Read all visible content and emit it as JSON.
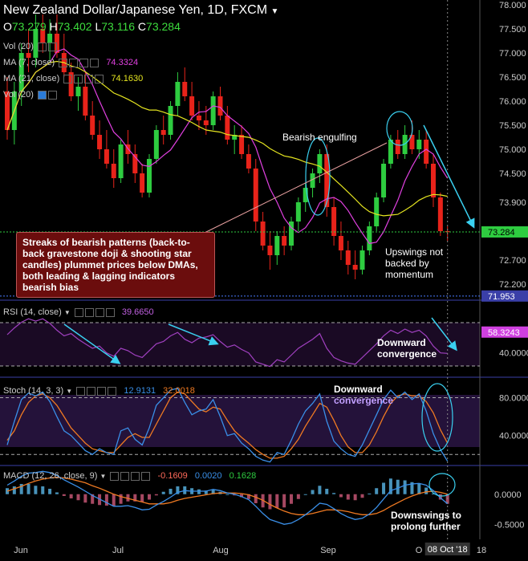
{
  "header": {
    "symbol": "New Zealand Dollar/Japanese Yen, 1D, FXCM",
    "open_label": "O",
    "open": "73.279",
    "high_label": "H",
    "high": "73.402",
    "low_label": "L",
    "low": "73.116",
    "close_label": "C",
    "close": "73.284"
  },
  "indicators": {
    "vol": "Vol (20)",
    "ma7": "MA (7, close)",
    "ma7_value": "74.3324",
    "ma21": "MA (21, close)",
    "ma21_value": "74.1630",
    "vol2": "Vol (20)",
    "rsi": "RSI (14, close)",
    "rsi_value": "39.6650",
    "stoch": "Stoch (14, 3, 3)",
    "stoch_k": "12.9131",
    "stoch_d": "32.0018",
    "macd": "MACD (12, 26, close, 9)",
    "macd_value": "-0.1609",
    "macd_signal": "0.0020",
    "macd_hist": "0.1628"
  },
  "annotations": {
    "callout": "Streaks of bearish patterns (back-to-back gravestone doji & shooting star candles) plummet prices below DMAs, both leading & lagging indicators bearish bias",
    "engulfing": "Bearish engulfing",
    "upswings": "Upswings not backed by momentum",
    "rsi_div_1": "Downward",
    "rsi_div_2": "convergence",
    "stoch_div_1": "Downward",
    "stoch_div_2": "convergence",
    "macd_note_1": "Downswings to",
    "macd_note_2": "prolong further"
  },
  "colors": {
    "up": "#2ecc40",
    "down": "#e8231a",
    "ma7": "#e040e0",
    "ma21": "#e5e520",
    "rsi": "#a040c0",
    "stoch_k": "#3a8fe8",
    "stoch_d": "#f07a22",
    "macd": "#3a8fe8",
    "signal": "#f07a22",
    "cyan": "#3ad0f0"
  },
  "chart_data": {
    "type": "candlestick",
    "price_axis": {
      "ticks": [
        "78.000",
        "77.500",
        "77.000",
        "76.500",
        "76.000",
        "75.500",
        "75.000",
        "74.500",
        "73.900",
        "73.300",
        "72.700",
        "72.200"
      ],
      "current": "73.284",
      "low_marker": "71.953",
      "ylim": [
        71.9,
        78.1
      ]
    },
    "x_axis": {
      "labels": [
        "Jun",
        "Jul",
        "Aug",
        "Sep",
        "O",
        "18"
      ],
      "current_date": "08 Oct '18"
    },
    "candles": [
      [
        76.2,
        76.5,
        75.2,
        75.4
      ],
      [
        75.4,
        76.4,
        75.1,
        76.2
      ],
      [
        76.2,
        77.2,
        75.9,
        77.0
      ],
      [
        77.0,
        77.5,
        76.6,
        76.9
      ],
      [
        76.9,
        77.8,
        76.7,
        77.5
      ],
      [
        77.5,
        77.8,
        77.0,
        77.2
      ],
      [
        77.2,
        77.7,
        76.8,
        77.4
      ],
      [
        77.4,
        77.8,
        76.9,
        77.0
      ],
      [
        77.0,
        77.4,
        76.5,
        76.6
      ],
      [
        76.6,
        76.8,
        76.0,
        76.1
      ],
      [
        76.1,
        76.5,
        75.8,
        76.3
      ],
      [
        76.3,
        76.6,
        75.6,
        75.7
      ],
      [
        75.7,
        76.0,
        75.2,
        75.3
      ],
      [
        75.3,
        75.6,
        74.8,
        75.0
      ],
      [
        75.0,
        75.4,
        74.6,
        74.7
      ],
      [
        74.7,
        75.0,
        74.2,
        74.4
      ],
      [
        74.4,
        75.2,
        74.3,
        75.1
      ],
      [
        75.1,
        75.4,
        74.7,
        74.9
      ],
      [
        74.9,
        75.1,
        74.3,
        74.5
      ],
      [
        74.5,
        74.7,
        74.0,
        74.1
      ],
      [
        74.1,
        74.9,
        74.0,
        74.8
      ],
      [
        74.8,
        75.5,
        74.7,
        75.4
      ],
      [
        75.4,
        75.7,
        75.1,
        75.3
      ],
      [
        75.3,
        76.0,
        75.2,
        75.9
      ],
      [
        75.9,
        76.6,
        75.7,
        76.4
      ],
      [
        76.4,
        76.7,
        76.0,
        76.1
      ],
      [
        76.1,
        76.4,
        75.6,
        75.7
      ],
      [
        75.7,
        76.0,
        75.4,
        75.6
      ],
      [
        75.6,
        75.9,
        75.3,
        75.5
      ],
      [
        75.5,
        76.2,
        75.4,
        76.1
      ],
      [
        76.1,
        76.3,
        75.6,
        75.7
      ],
      [
        75.7,
        75.9,
        75.1,
        75.2
      ],
      [
        75.2,
        75.5,
        74.9,
        75.3
      ],
      [
        75.3,
        75.5,
        74.8,
        74.9
      ],
      [
        74.9,
        75.1,
        74.5,
        74.6
      ],
      [
        74.6,
        74.8,
        73.3,
        73.5
      ],
      [
        73.5,
        73.7,
        72.9,
        73.0
      ],
      [
        73.0,
        73.3,
        72.5,
        72.8
      ],
      [
        72.8,
        73.3,
        72.6,
        73.2
      ],
      [
        73.2,
        73.4,
        72.8,
        73.0
      ],
      [
        73.0,
        73.6,
        72.9,
        73.5
      ],
      [
        73.5,
        74.0,
        73.3,
        73.9
      ],
      [
        73.9,
        74.3,
        73.7,
        74.2
      ],
      [
        74.2,
        74.6,
        74.0,
        74.5
      ],
      [
        74.5,
        75.0,
        74.3,
        74.9
      ],
      [
        74.9,
        75.1,
        73.6,
        73.8
      ],
      [
        73.8,
        74.0,
        73.0,
        73.2
      ],
      [
        73.2,
        73.5,
        72.7,
        72.9
      ],
      [
        72.9,
        73.1,
        72.4,
        72.6
      ],
      [
        72.6,
        72.9,
        72.3,
        72.5
      ],
      [
        72.5,
        73.0,
        72.4,
        72.9
      ],
      [
        72.9,
        73.5,
        72.8,
        73.4
      ],
      [
        73.4,
        74.1,
        73.3,
        74.0
      ],
      [
        74.0,
        74.8,
        73.9,
        74.7
      ],
      [
        74.7,
        75.3,
        74.6,
        75.2
      ],
      [
        75.2,
        75.4,
        74.8,
        74.9
      ],
      [
        74.9,
        75.5,
        74.8,
        75.3
      ],
      [
        75.3,
        75.6,
        74.9,
        75.0
      ],
      [
        75.0,
        75.4,
        74.8,
        75.2
      ],
      [
        75.2,
        75.4,
        74.6,
        74.7
      ],
      [
        74.7,
        74.9,
        73.8,
        74.0
      ],
      [
        74.0,
        74.1,
        73.2,
        73.3
      ],
      [
        73.3,
        73.4,
        73.1,
        73.28
      ]
    ],
    "rsi_axis": {
      "ticks": [
        "40.0000"
      ],
      "current": "58.3243",
      "ylim": [
        20,
        85
      ]
    },
    "rsi": [
      56,
      62,
      67,
      70,
      68,
      70,
      66,
      60,
      55,
      57,
      52,
      48,
      44,
      46,
      40,
      37,
      44,
      42,
      38,
      36,
      42,
      48,
      50,
      55,
      58,
      52,
      49,
      53,
      54,
      56,
      50,
      45,
      47,
      43,
      40,
      32,
      30,
      28,
      34,
      32,
      38,
      44,
      48,
      52,
      57,
      44,
      36,
      33,
      31,
      30,
      36,
      42,
      48,
      55,
      60,
      57,
      61,
      58,
      60,
      55,
      46,
      40,
      39.6
    ],
    "stoch_axis": {
      "ticks": [
        "80.0000",
        "40.0000"
      ],
      "ylim": [
        10,
        100
      ]
    },
    "stoch_k": [
      30,
      55,
      78,
      85,
      82,
      86,
      76,
      60,
      45,
      40,
      32,
      24,
      20,
      26,
      22,
      20,
      45,
      48,
      36,
      30,
      48,
      72,
      80,
      88,
      90,
      75,
      62,
      66,
      68,
      78,
      60,
      40,
      42,
      32,
      26,
      18,
      14,
      12,
      22,
      20,
      35,
      52,
      66,
      74,
      84,
      55,
      34,
      26,
      20,
      18,
      30,
      46,
      62,
      78,
      88,
      80,
      86,
      78,
      84,
      66,
      42,
      25,
      12.9
    ],
    "stoch_d": [
      35,
      45,
      62,
      75,
      82,
      84,
      80,
      72,
      60,
      48,
      40,
      32,
      26,
      24,
      22,
      22,
      30,
      38,
      42,
      38,
      38,
      52,
      66,
      80,
      86,
      84,
      76,
      68,
      65,
      70,
      68,
      56,
      45,
      38,
      32,
      25,
      20,
      16,
      16,
      18,
      26,
      36,
      50,
      62,
      74,
      70,
      56,
      40,
      28,
      22,
      22,
      30,
      44,
      60,
      74,
      82,
      84,
      82,
      82,
      76,
      64,
      46,
      32.0
    ],
    "macd_axis": {
      "ticks": [
        "0.0000",
        "-0.5000"
      ],
      "ylim": [
        -0.75,
        0.45
      ]
    },
    "macd": [
      0.15,
      0.22,
      0.3,
      0.35,
      0.36,
      0.38,
      0.36,
      0.31,
      0.24,
      0.18,
      0.12,
      0.05,
      -0.02,
      -0.08,
      -0.14,
      -0.2,
      -0.2,
      -0.19,
      -0.22,
      -0.26,
      -0.25,
      -0.18,
      -0.12,
      -0.05,
      0.03,
      0.06,
      0.05,
      0.05,
      0.05,
      0.08,
      0.06,
      0.02,
      0.0,
      -0.04,
      -0.09,
      -0.2,
      -0.32,
      -0.42,
      -0.46,
      -0.5,
      -0.48,
      -0.42,
      -0.34,
      -0.25,
      -0.15,
      -0.17,
      -0.24,
      -0.32,
      -0.38,
      -0.42,
      -0.4,
      -0.33,
      -0.22,
      -0.08,
      0.06,
      0.1,
      0.15,
      0.17,
      0.18,
      0.15,
      0.06,
      -0.06,
      -0.16
    ],
    "macd_signal": [
      0.05,
      0.09,
      0.13,
      0.18,
      0.22,
      0.25,
      0.27,
      0.28,
      0.27,
      0.25,
      0.22,
      0.19,
      0.14,
      0.1,
      0.05,
      0.0,
      -0.04,
      -0.07,
      -0.1,
      -0.13,
      -0.16,
      -0.16,
      -0.16,
      -0.14,
      -0.1,
      -0.07,
      -0.05,
      -0.03,
      -0.01,
      0.01,
      0.02,
      0.02,
      0.02,
      0.01,
      -0.01,
      -0.05,
      -0.1,
      -0.17,
      -0.23,
      -0.28,
      -0.32,
      -0.34,
      -0.34,
      -0.32,
      -0.29,
      -0.26,
      -0.26,
      -0.27,
      -0.29,
      -0.32,
      -0.34,
      -0.34,
      -0.32,
      -0.27,
      -0.2,
      -0.14,
      -0.08,
      -0.03,
      0.01,
      0.04,
      0.05,
      0.03,
      0.0
    ]
  }
}
